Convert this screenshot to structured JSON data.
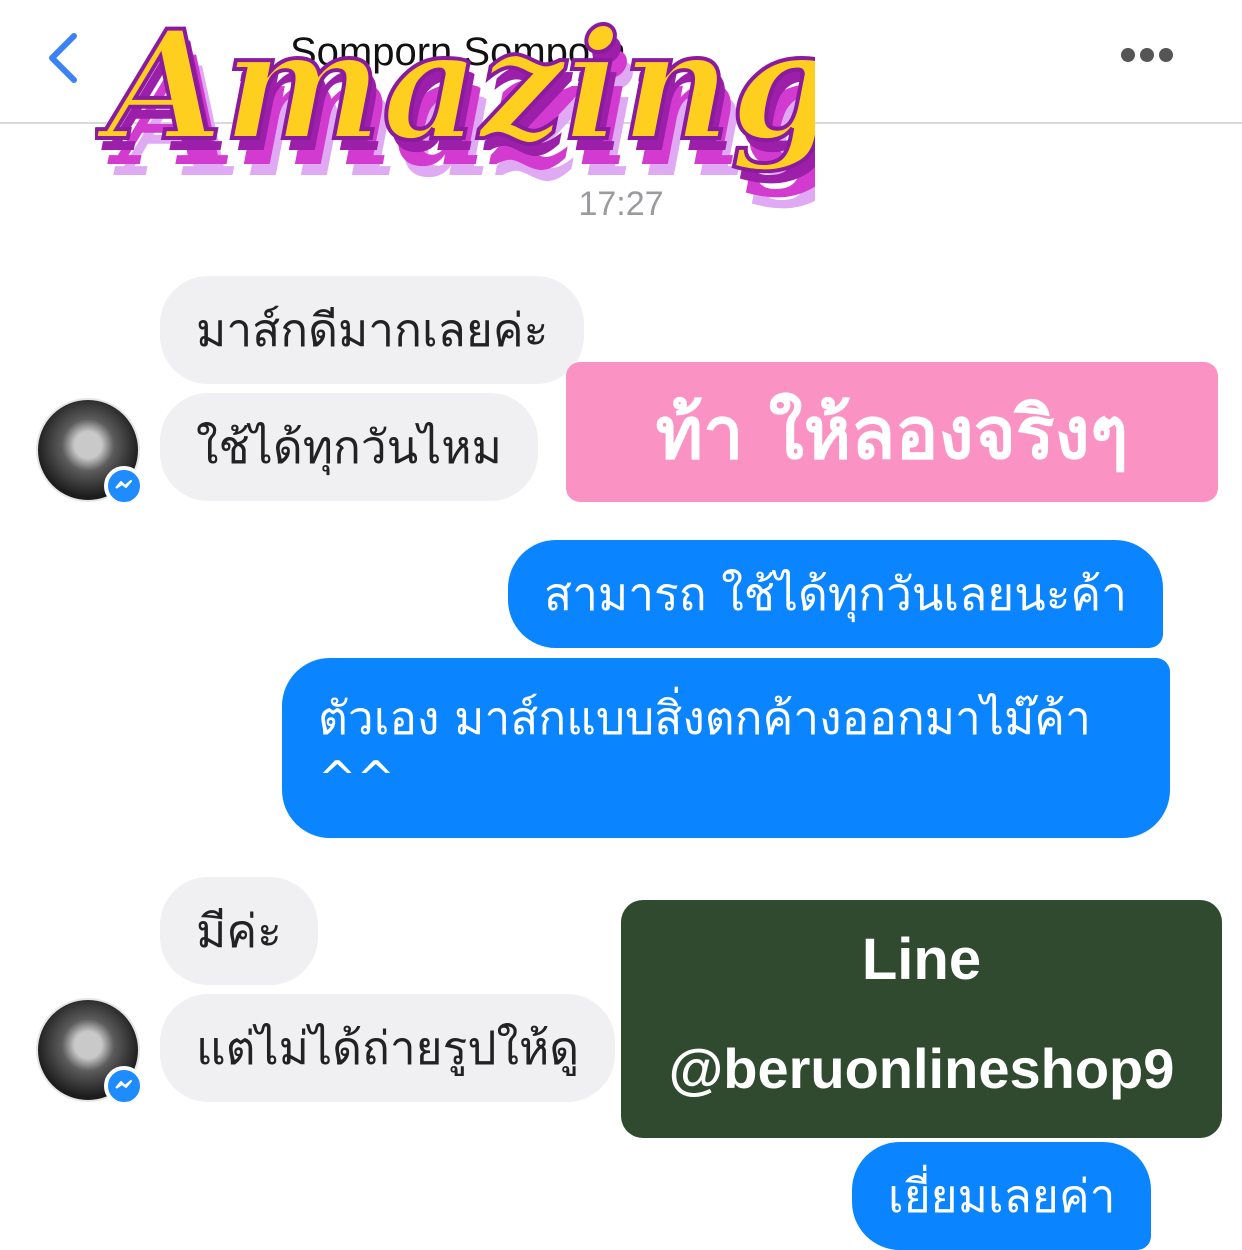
{
  "header": {
    "contact_name": "Somporn Somporn",
    "back_icon": "chevron-left-icon",
    "more_icon": "ellipsis-icon"
  },
  "overlay": {
    "sticker_text": "Amazing"
  },
  "timestamp": "17:27",
  "messages": [
    {
      "side": "in",
      "text": "มาส์กดีมากเลยค่ะ"
    },
    {
      "side": "in",
      "text": "ใช้ได้ทุกวันไหม"
    },
    {
      "side": "out",
      "text": "สามารถ ใช้ได้ทุกวันเลยนะค้า"
    },
    {
      "side": "out",
      "line1": "ตัวเอง มาส์กแบบสิ่งตกค้างออกมาไม๊ค้า",
      "line2": "^^"
    },
    {
      "side": "in",
      "text": "มีค่ะ"
    },
    {
      "side": "in",
      "text": "แต่ไม่ได้ถ่ายรูปให้ดู"
    },
    {
      "side": "out",
      "text": "เยี่ยมเลยค่า"
    }
  ],
  "banners": {
    "pink": "ท้า ให้ลองจริงๆ",
    "line_label": "Line",
    "line_id": "@beruonlineshop9"
  },
  "colors": {
    "outgoing_bubble": "#0a84ff",
    "incoming_bubble": "#f0f0f2",
    "pink_banner": "#fb92c4",
    "green_box": "#2f4a2e",
    "sticker_yellow": "#ffcf1f",
    "sticker_magenta": "#d23ad0"
  }
}
